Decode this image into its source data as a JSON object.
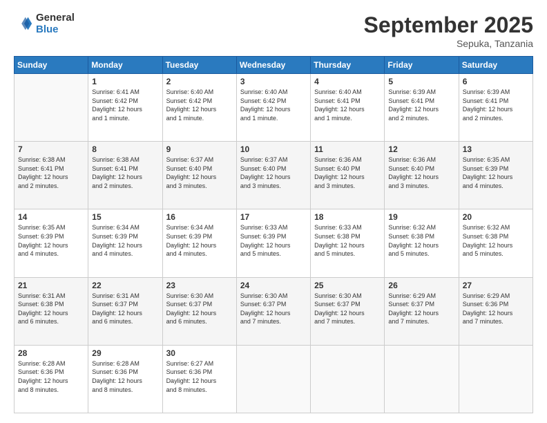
{
  "header": {
    "logo_general": "General",
    "logo_blue": "Blue",
    "month_title": "September 2025",
    "subtitle": "Sepuka, Tanzania"
  },
  "days_of_week": [
    "Sunday",
    "Monday",
    "Tuesday",
    "Wednesday",
    "Thursday",
    "Friday",
    "Saturday"
  ],
  "weeks": [
    [
      {
        "day": "",
        "info": ""
      },
      {
        "day": "1",
        "info": "Sunrise: 6:41 AM\nSunset: 6:42 PM\nDaylight: 12 hours\nand 1 minute."
      },
      {
        "day": "2",
        "info": "Sunrise: 6:40 AM\nSunset: 6:42 PM\nDaylight: 12 hours\nand 1 minute."
      },
      {
        "day": "3",
        "info": "Sunrise: 6:40 AM\nSunset: 6:42 PM\nDaylight: 12 hours\nand 1 minute."
      },
      {
        "day": "4",
        "info": "Sunrise: 6:40 AM\nSunset: 6:41 PM\nDaylight: 12 hours\nand 1 minute."
      },
      {
        "day": "5",
        "info": "Sunrise: 6:39 AM\nSunset: 6:41 PM\nDaylight: 12 hours\nand 2 minutes."
      },
      {
        "day": "6",
        "info": "Sunrise: 6:39 AM\nSunset: 6:41 PM\nDaylight: 12 hours\nand 2 minutes."
      }
    ],
    [
      {
        "day": "7",
        "info": "Sunrise: 6:38 AM\nSunset: 6:41 PM\nDaylight: 12 hours\nand 2 minutes."
      },
      {
        "day": "8",
        "info": "Sunrise: 6:38 AM\nSunset: 6:41 PM\nDaylight: 12 hours\nand 2 minutes."
      },
      {
        "day": "9",
        "info": "Sunrise: 6:37 AM\nSunset: 6:40 PM\nDaylight: 12 hours\nand 3 minutes."
      },
      {
        "day": "10",
        "info": "Sunrise: 6:37 AM\nSunset: 6:40 PM\nDaylight: 12 hours\nand 3 minutes."
      },
      {
        "day": "11",
        "info": "Sunrise: 6:36 AM\nSunset: 6:40 PM\nDaylight: 12 hours\nand 3 minutes."
      },
      {
        "day": "12",
        "info": "Sunrise: 6:36 AM\nSunset: 6:40 PM\nDaylight: 12 hours\nand 3 minutes."
      },
      {
        "day": "13",
        "info": "Sunrise: 6:35 AM\nSunset: 6:39 PM\nDaylight: 12 hours\nand 4 minutes."
      }
    ],
    [
      {
        "day": "14",
        "info": "Sunrise: 6:35 AM\nSunset: 6:39 PM\nDaylight: 12 hours\nand 4 minutes."
      },
      {
        "day": "15",
        "info": "Sunrise: 6:34 AM\nSunset: 6:39 PM\nDaylight: 12 hours\nand 4 minutes."
      },
      {
        "day": "16",
        "info": "Sunrise: 6:34 AM\nSunset: 6:39 PM\nDaylight: 12 hours\nand 4 minutes."
      },
      {
        "day": "17",
        "info": "Sunrise: 6:33 AM\nSunset: 6:39 PM\nDaylight: 12 hours\nand 5 minutes."
      },
      {
        "day": "18",
        "info": "Sunrise: 6:33 AM\nSunset: 6:38 PM\nDaylight: 12 hours\nand 5 minutes."
      },
      {
        "day": "19",
        "info": "Sunrise: 6:32 AM\nSunset: 6:38 PM\nDaylight: 12 hours\nand 5 minutes."
      },
      {
        "day": "20",
        "info": "Sunrise: 6:32 AM\nSunset: 6:38 PM\nDaylight: 12 hours\nand 5 minutes."
      }
    ],
    [
      {
        "day": "21",
        "info": "Sunrise: 6:31 AM\nSunset: 6:38 PM\nDaylight: 12 hours\nand 6 minutes."
      },
      {
        "day": "22",
        "info": "Sunrise: 6:31 AM\nSunset: 6:37 PM\nDaylight: 12 hours\nand 6 minutes."
      },
      {
        "day": "23",
        "info": "Sunrise: 6:30 AM\nSunset: 6:37 PM\nDaylight: 12 hours\nand 6 minutes."
      },
      {
        "day": "24",
        "info": "Sunrise: 6:30 AM\nSunset: 6:37 PM\nDaylight: 12 hours\nand 7 minutes."
      },
      {
        "day": "25",
        "info": "Sunrise: 6:30 AM\nSunset: 6:37 PM\nDaylight: 12 hours\nand 7 minutes."
      },
      {
        "day": "26",
        "info": "Sunrise: 6:29 AM\nSunset: 6:37 PM\nDaylight: 12 hours\nand 7 minutes."
      },
      {
        "day": "27",
        "info": "Sunrise: 6:29 AM\nSunset: 6:36 PM\nDaylight: 12 hours\nand 7 minutes."
      }
    ],
    [
      {
        "day": "28",
        "info": "Sunrise: 6:28 AM\nSunset: 6:36 PM\nDaylight: 12 hours\nand 8 minutes."
      },
      {
        "day": "29",
        "info": "Sunrise: 6:28 AM\nSunset: 6:36 PM\nDaylight: 12 hours\nand 8 minutes."
      },
      {
        "day": "30",
        "info": "Sunrise: 6:27 AM\nSunset: 6:36 PM\nDaylight: 12 hours\nand 8 minutes."
      },
      {
        "day": "",
        "info": ""
      },
      {
        "day": "",
        "info": ""
      },
      {
        "day": "",
        "info": ""
      },
      {
        "day": "",
        "info": ""
      }
    ]
  ]
}
